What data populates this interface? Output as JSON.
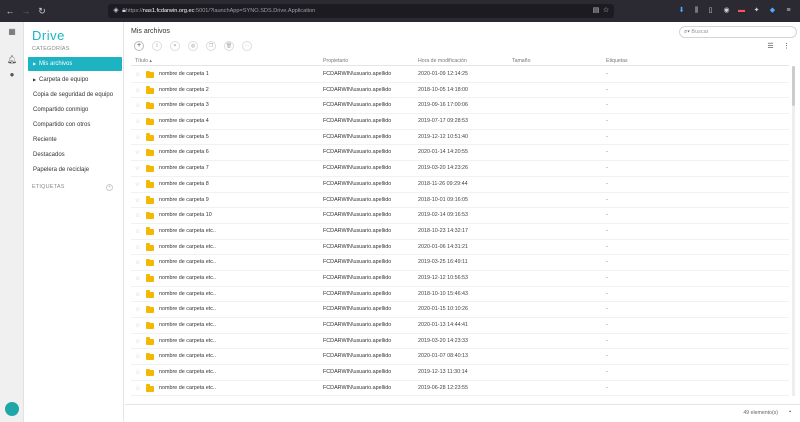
{
  "browser": {
    "url_prefix": "https://",
    "url_domain": "nas1.fcdarwin.org.ec",
    "url_suffix": ":5001/?launchApp=SYNO.SDS.Drive.Application"
  },
  "sidebar": {
    "logo": "Drive",
    "categories_label": "CATEGORÍAS",
    "tags_label": "ETIQUETAS",
    "items": [
      {
        "label": "Mis archivos"
      },
      {
        "label": "Carpeta de equipo"
      },
      {
        "label": "Copia de seguridad de equipo"
      },
      {
        "label": "Compartido conmigo"
      },
      {
        "label": "Compartido con otros"
      },
      {
        "label": "Reciente"
      },
      {
        "label": "Destacados"
      },
      {
        "label": "Papelera de reciclaje"
      }
    ]
  },
  "main": {
    "title": "Mis archivos",
    "search_placeholder": "Buscar",
    "columns": {
      "title": "Título",
      "owner": "Propietario",
      "modified": "Hora de modificación",
      "size": "Tamaño",
      "tags": "Etiquetas"
    },
    "rows": [
      {
        "name": "nombre de carpeta 1",
        "owner": "FCDARWIN\\usuario.apellido",
        "date": "2020-01-09 12:14:25",
        "tags": "-"
      },
      {
        "name": "nombre de carpeta 2",
        "owner": "FCDARWIN\\usuario.apellido",
        "date": "2018-10-05 14:18:00",
        "tags": "-"
      },
      {
        "name": "nombre de carpeta 3",
        "owner": "FCDARWIN\\usuario.apellido",
        "date": "2019-09-16 17:00:06",
        "tags": "-"
      },
      {
        "name": "nombre de carpeta 4",
        "owner": "FCDARWIN\\usuario.apellido",
        "date": "2019-07-17 09:28:53",
        "tags": "-"
      },
      {
        "name": "nombre de carpeta 5",
        "owner": "FCDARWIN\\usuario.apellido",
        "date": "2019-12-12 10:51:40",
        "tags": "-"
      },
      {
        "name": "nombre de carpeta 6",
        "owner": "FCDARWIN\\usuario.apellido",
        "date": "2020-01-14 14:20:55",
        "tags": "-"
      },
      {
        "name": "nombre de carpeta 7",
        "owner": "FCDARWIN\\usuario.apellido",
        "date": "2019-03-20 14:23:26",
        "tags": "-"
      },
      {
        "name": "nombre de carpeta 8",
        "owner": "FCDARWIN\\usuario.apellido",
        "date": "2018-11-26 09:29:44",
        "tags": "-"
      },
      {
        "name": "nombre de carpeta 9",
        "owner": "FCDARWIN\\usuario.apellido",
        "date": "2018-10-01 09:16:05",
        "tags": "-"
      },
      {
        "name": "nombre de carpeta 10",
        "owner": "FCDARWIN\\usuario.apellido",
        "date": "2019-02-14 09:16:53",
        "tags": "-"
      },
      {
        "name": "nombre de carpeta etc..",
        "owner": "FCDARWIN\\usuario.apellido",
        "date": "2018-10-23 14:32:17",
        "tags": "-"
      },
      {
        "name": "nombre de carpeta etc..",
        "owner": "FCDARWIN\\usuario.apellido",
        "date": "2020-01-06 14:31:21",
        "tags": "-"
      },
      {
        "name": "nombre de carpeta etc..",
        "owner": "FCDARWIN\\usuario.apellido",
        "date": "2019-03-25 16:49:11",
        "tags": "-"
      },
      {
        "name": "nombre de carpeta etc..",
        "owner": "FCDARWIN\\usuario.apellido",
        "date": "2019-12-12 10:56:53",
        "tags": "-"
      },
      {
        "name": "nombre de carpeta etc..",
        "owner": "FCDARWIN\\usuario.apellido",
        "date": "2018-10-10 15:46:43",
        "tags": "-"
      },
      {
        "name": "nombre de carpeta etc..",
        "owner": "FCDARWIN\\usuario.apellido",
        "date": "2020-01-15 10:10:26",
        "tags": "-"
      },
      {
        "name": "nombre de carpeta etc..",
        "owner": "FCDARWIN\\usuario.apellido",
        "date": "2020-01-13 14:44:41",
        "tags": "-"
      },
      {
        "name": "nombre de carpeta etc..",
        "owner": "FCDARWIN\\usuario.apellido",
        "date": "2019-03-20 14:23:33",
        "tags": "-"
      },
      {
        "name": "nombre de carpeta etc..",
        "owner": "FCDARWIN\\usuario.apellido",
        "date": "2020-01-07 08:40:13",
        "tags": "-"
      },
      {
        "name": "nombre de carpeta etc..",
        "owner": "FCDARWIN\\usuario.apellido",
        "date": "2019-12-13 11:30:14",
        "tags": "-"
      },
      {
        "name": "nombre de carpeta etc..",
        "owner": "FCDARWIN\\usuario.apellido",
        "date": "2019-06-28 12:23:55",
        "tags": "-"
      }
    ],
    "item_count": "49 elemento(s)"
  },
  "colors": {
    "accent": "#1eb3c2",
    "folder": "#f5b800",
    "browser_bg": "#2b2a33"
  }
}
